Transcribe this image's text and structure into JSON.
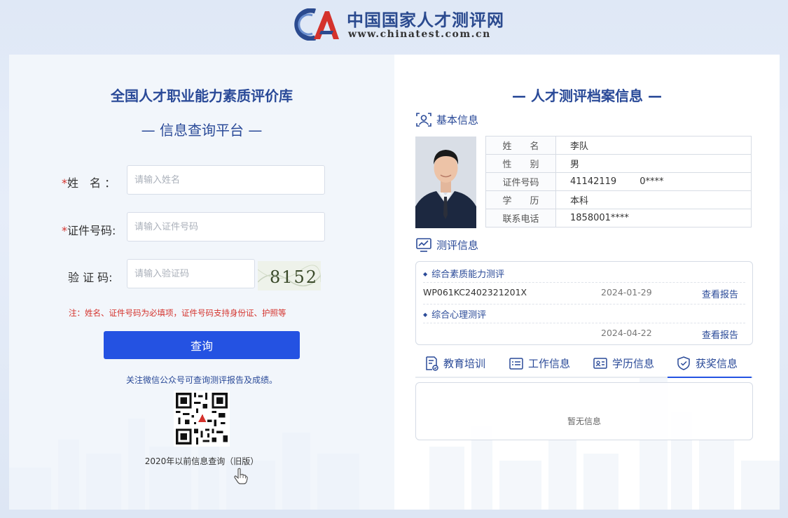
{
  "header": {
    "site_name": "中国国家人才测评网",
    "site_url": "www.chinatest.com.cn",
    "logo_icon": "ca-logo-icon",
    "brand_colors": {
      "navy": "#2b4a8f",
      "red": "#d4322c"
    }
  },
  "query_form": {
    "title": "全国人才职业能力素质评价库",
    "subtitle": "— 信息查询平台 —",
    "fields": {
      "name": {
        "label": "姓　名 ：",
        "required": true,
        "placeholder": "请输入姓名",
        "value": ""
      },
      "id_number": {
        "label": "证件号码:",
        "required": true,
        "placeholder": "请输入证件号码",
        "value": ""
      },
      "captcha": {
        "label": "验 证 码:",
        "required": false,
        "placeholder": "请输入验证码",
        "value": "",
        "image_text": "8152"
      }
    },
    "required_mark": "*",
    "note": "注：姓名、证件号码为必填项，证件号码支持身份证、护照等",
    "submit_label": "查询",
    "accent_color": "#2452e2",
    "wechat_note": "关注微信公众号可查询测评报告及成绩。",
    "old_version_link": "2020年以前信息查询（旧版）"
  },
  "archive": {
    "title": "— 人才测评档案信息 —",
    "basic_section": {
      "heading": "基本信息",
      "icon": "user-card-icon",
      "rows": [
        {
          "label": "姓　　名",
          "value": "李队"
        },
        {
          "label": "性　　别",
          "value": "男"
        },
        {
          "label": "证件号码",
          "value": "41142119        0****"
        },
        {
          "label": "学　　历",
          "value": "本科"
        },
        {
          "label": "联系电话",
          "value": "1858001****"
        }
      ]
    },
    "eval_section": {
      "heading": "测评信息",
      "icon": "chart-monitor-icon",
      "items": [
        {
          "type": "综合素质能力测评",
          "code": "WP061KC2402321201X",
          "date": "2024-01-29",
          "link": "查看报告"
        },
        {
          "type": "综合心理测评",
          "code": "",
          "date": "2024-04-22",
          "link": "查看报告"
        }
      ]
    },
    "tabs": [
      {
        "label": "教育培训",
        "icon": "education-doc-icon",
        "active": false
      },
      {
        "label": "工作信息",
        "icon": "work-list-icon",
        "active": false
      },
      {
        "label": "学历信息",
        "icon": "id-card-icon",
        "active": false
      },
      {
        "label": "获奖信息",
        "icon": "award-shield-icon",
        "active": true
      }
    ],
    "empty_text": "暂无信息"
  }
}
